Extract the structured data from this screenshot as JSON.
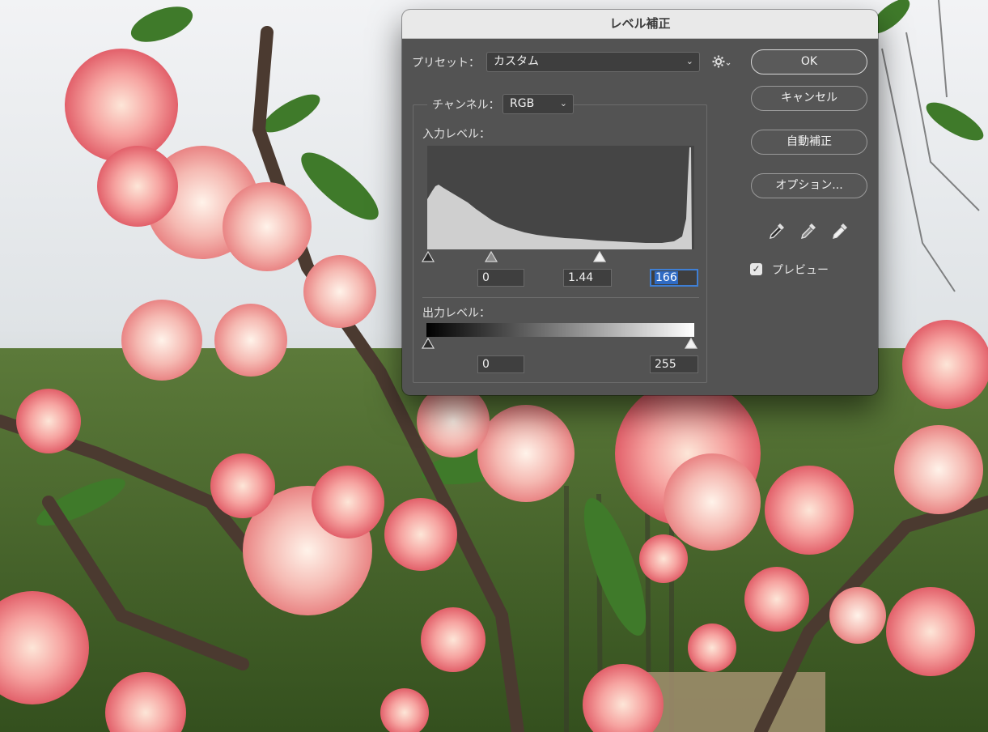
{
  "dialog": {
    "title": "レベル補正",
    "preset_label": "プリセット：",
    "preset_value": "カスタム",
    "preset_options_icon": "gear-icon",
    "channel_label": "チャンネル：",
    "channel_value": "RGB",
    "input_levels_label": "入力レベル：",
    "input_black": "0",
    "input_gamma": "1.44",
    "input_white": "166",
    "output_levels_label": "出力レベル：",
    "output_black": "0",
    "output_white": "255",
    "buttons": {
      "ok": "OK",
      "cancel": "キャンセル",
      "auto": "自動補正",
      "options": "オプション..."
    },
    "eyedroppers": [
      "black-point-eyedropper-icon",
      "gray-point-eyedropper-icon",
      "white-point-eyedropper-icon"
    ],
    "preview_label": "プレビュー",
    "preview_checked": true
  },
  "colors": {
    "dialog_bg": "#535353",
    "histogram_bg": "#454545",
    "histogram_fill": "#cfcfcf",
    "selection_blue": "#2f6bc4"
  }
}
